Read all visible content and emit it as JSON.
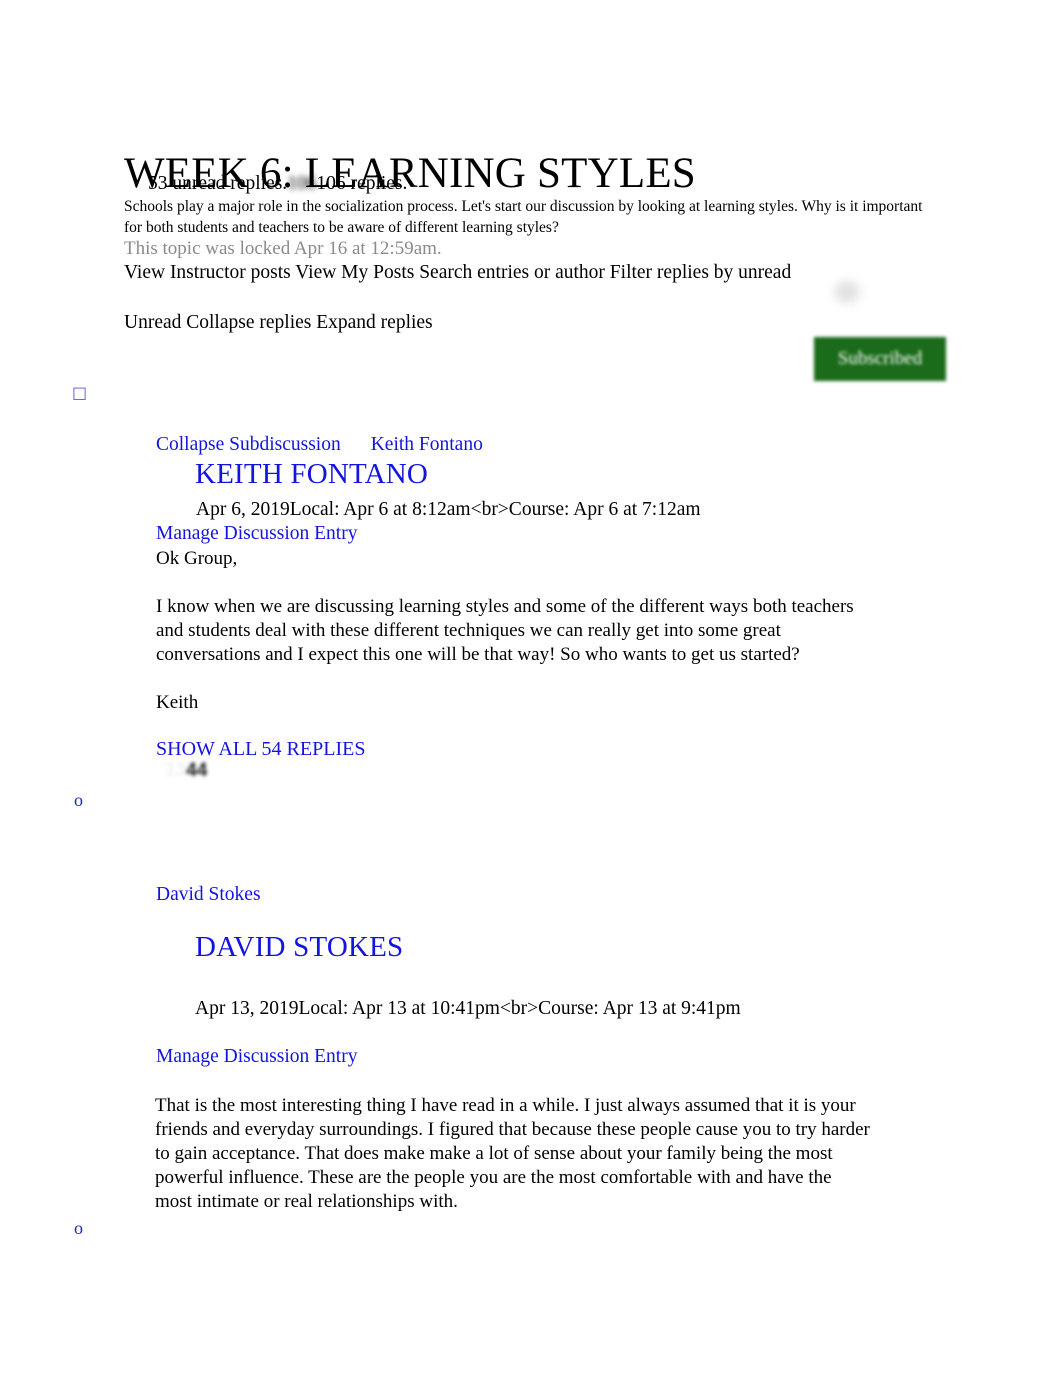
{
  "document": {
    "title": "WEEK 6: LEARNING STYLES",
    "reply_counts": {
      "unread": "53 unread replies.",
      "total_blurred": "106",
      "total": "106 replies."
    },
    "prompt": "Schools play a major role in the socialization process. Let's start our discussion by looking at learning styles. Why is it important for both students and teachers to be aware of different learning styles?",
    "locked_note": "This topic was locked Apr 16 at 12:59am."
  },
  "toolbar": {
    "row1": "View Instructor posts View My Posts Search entries or author Filter replies by unread",
    "row2": "Unread Collapse replies Expand replies",
    "subscribed_label": "Subscribed",
    "subscribed_color": "#1a6b1a"
  },
  "markers": {
    "tofu": "□",
    "bullet": "o"
  },
  "entries": [
    {
      "collapse_label": "Collapse Subdiscussion",
      "author_link": "Keith Fontano",
      "author_heading": "KEITH FONTANO",
      "timestamp": "Apr 6, 2019Local: Apr 6 at 8:12am<br>Course: Apr 6 at 7:12am",
      "manage_label": "Manage Discussion Entry",
      "body_lines": [
        "Ok Group,",
        "",
        "I know when we are discussing learning styles and some of the different ways both teachers and students deal with these different techniques we can really get into some great conversations and I expect this one will be that way! So who wants to get us started?",
        "",
        "Keith"
      ],
      "show_replies_label": "SHOW ALL 54 REPLIES",
      "badge_pale": "13",
      "badge_dark": "44"
    },
    {
      "author_link": "David Stokes",
      "author_heading": "DAVID STOKES",
      "timestamp": "Apr 13, 2019Local: Apr 13 at 10:41pm<br>Course: Apr 13 at 9:41pm",
      "manage_label": "Manage Discussion Entry",
      "body_lines": [
        "That is the most interesting thing I have read in a while. I just always assumed that it is your friends and everyday surroundings. I figured that because these people cause you to try harder to gain acceptance. That does make make a lot of sense about your family being the most powerful influence. These are the people you are the most comfortable with and have the most intimate or real relationships with."
      ]
    }
  ]
}
